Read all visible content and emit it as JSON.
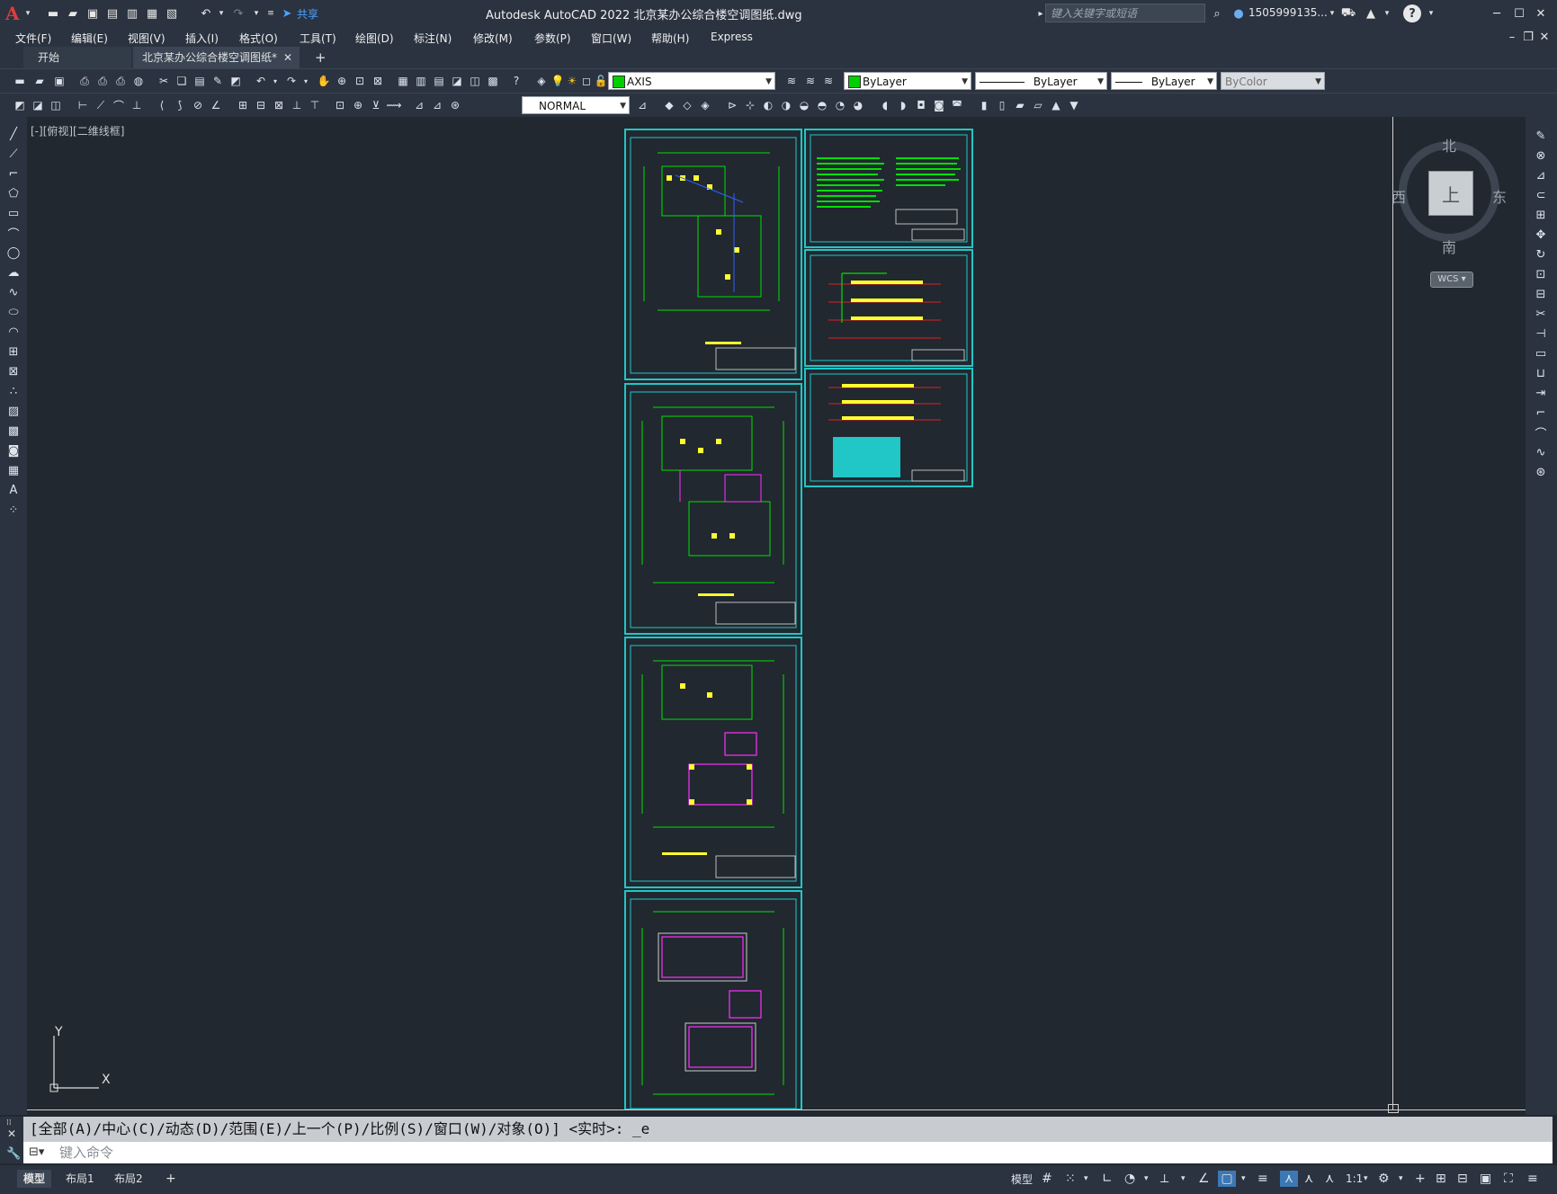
{
  "window": {
    "app_logo": "A",
    "title": "Autodesk AutoCAD 2022    北京某办公综合楼空调图纸.dwg",
    "share_label": "共享",
    "search_placeholder": "键入关键字或短语",
    "user": "1505999135...",
    "help": "?"
  },
  "menus": [
    "文件(F)",
    "编辑(E)",
    "视图(V)",
    "插入(I)",
    "格式(O)",
    "工具(T)",
    "绘图(D)",
    "标注(N)",
    "修改(M)",
    "参数(P)",
    "窗口(W)",
    "帮助(H)",
    "Express"
  ],
  "tabs": {
    "start": "开始",
    "active": "北京某办公综合楼空调图纸*",
    "close": "✕",
    "new": "+"
  },
  "layer_toolbar": {
    "layer_name": "AXIS",
    "color": "ByLayer",
    "linetype": "ByLayer",
    "lineweight": "ByLayer",
    "plotstyle": "ByColor",
    "layer_color_hex": "#00d000"
  },
  "style_toolbar": {
    "text_style": "NORMAL"
  },
  "viewport": {
    "label": "[-][俯视][二维线框]",
    "compass": {
      "north": "北",
      "south": "南",
      "east": "东",
      "west": "西"
    },
    "cube_face": "上",
    "wcs": "WCS",
    "ucs_x": "X",
    "ucs_y": "Y"
  },
  "command": {
    "history": "[全部(A)/中心(C)/动态(D)/范围(E)/上一个(P)/比例(S)/窗口(W)/对象(O)] <实时>: _e",
    "placeholder": "键入命令"
  },
  "status": {
    "layouts": [
      "模型",
      "布局1",
      "布局2"
    ],
    "add_layout": "+",
    "model_btn": "模型",
    "scale": "1:1"
  },
  "colors": {
    "sheet_border": "#21c6c6",
    "canvas_bg": "#212830",
    "ui_bg": "#2b3340"
  }
}
